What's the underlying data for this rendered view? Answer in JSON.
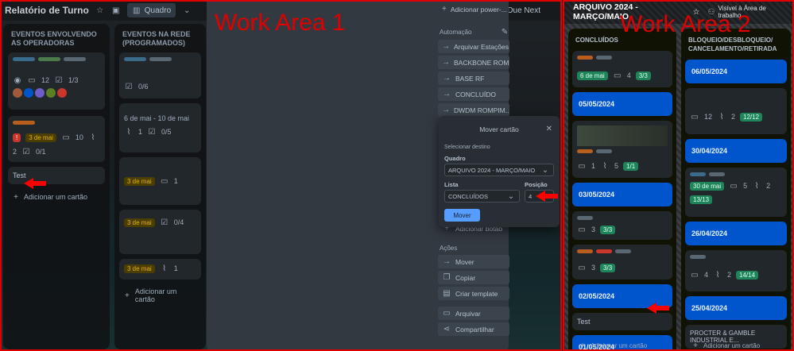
{
  "left": {
    "work_area_label": "Work Area 1",
    "board_title": "Relatório de Turno",
    "view_button": "Quadro",
    "due_next": "Due Next",
    "lists": [
      {
        "title": "EVENTOS ENVOLVENDO AS OPERADORAS",
        "test_card": "Test",
        "add_card": "Adicionar um cartão",
        "card1_badges": {
          "comments": "12",
          "checklist": "1/3"
        },
        "card2_badges": {
          "date": "3 de mai",
          "comments": "10",
          "attachments": "2",
          "checklist": "0/1"
        }
      },
      {
        "title": "EVENTOS NA REDE (PROGRAMADOS)",
        "add_card": "Adicionar um cartão",
        "card1_badges": {
          "checklist": "0/6"
        },
        "card2_badges": {
          "date": "6 de mai - 10 de mai",
          "attachments": "1",
          "checklist": "0/5"
        },
        "card3_badges": {
          "date": "3 de mai",
          "comments": "1"
        },
        "card4_badges": {
          "date": "3 de mai",
          "checklist": "0/4"
        },
        "card5_badges": {
          "date": "3 de mai",
          "attachments": "1"
        }
      }
    ],
    "card_sidebar": {
      "add_powerup": "Adicionar power-...",
      "automation_title": "Automação",
      "automation_buttons": [
        "Arquivar Estações",
        "BACKBONE ROM...",
        "BASE RF",
        "CONCLUÍDO",
        "DWDM ROMPIM..."
      ],
      "add_button": "Adicionar botão",
      "actions_title": "Ações",
      "action_buttons": [
        "Mover",
        "Copiar",
        "Criar template",
        "Arquivar",
        "Compartilhar"
      ]
    },
    "move_popover": {
      "title": "Mover cartão",
      "select_destination": "Selecionar destino",
      "board_label": "Quadro",
      "board_value": "ARQUIVO 2024 - MARÇO/MAIO",
      "list_label": "Lista",
      "list_value": "CONCLUÍDOS",
      "position_label": "Posição",
      "position_value": "4",
      "move_button": "Mover"
    }
  },
  "right": {
    "work_area_label": "Work Area 2",
    "board_title": "ARQUIVO 2024 - MARÇO/MAIO",
    "visibility": "Visível à Área de trabalho",
    "lists": [
      {
        "title": "CONCLUÍDOS",
        "top_card_badges": {
          "date": "6 de mai",
          "comments": "4",
          "checklist": "3/3"
        },
        "date_cards": [
          "05/05/2024",
          "03/05/2024",
          "02/05/2024",
          "01/05/2024"
        ],
        "card_mid_badges": {
          "comments": "1",
          "attachments": "5",
          "checklist": "1/1"
        },
        "card_a_badges": {
          "comments": "3",
          "checklist": "3/3"
        },
        "card_b_badges": {
          "comments": "3",
          "checklist": "3/3"
        },
        "test_card": "Test",
        "add_card": "Adicionar um cartão"
      },
      {
        "title": "BLOQUEIO/DESBLOQUEIO/ CANCELAMENTO/RETIRADA",
        "date_cards": [
          "06/05/2024",
          "30/04/2024",
          "26/04/2024",
          "25/04/2024"
        ],
        "card1_badges": {
          "comments": "12",
          "attachments": "2",
          "checklist": "12/12"
        },
        "card2_badges": {
          "date": "30 de mai",
          "comments": "5",
          "attachments": "2",
          "checklist": "13/13"
        },
        "card3_badges": {
          "comments": "4",
          "attachments": "2",
          "checklist": "14/14"
        },
        "last_card": "PROCTER & GAMBLE INDUSTRIAL E...",
        "add_card": "Adicionar um cartão"
      }
    ]
  },
  "colors": {
    "annotation_red": "#e00000",
    "date_card_blue": "#0055cc",
    "move_button": "#579dff"
  }
}
